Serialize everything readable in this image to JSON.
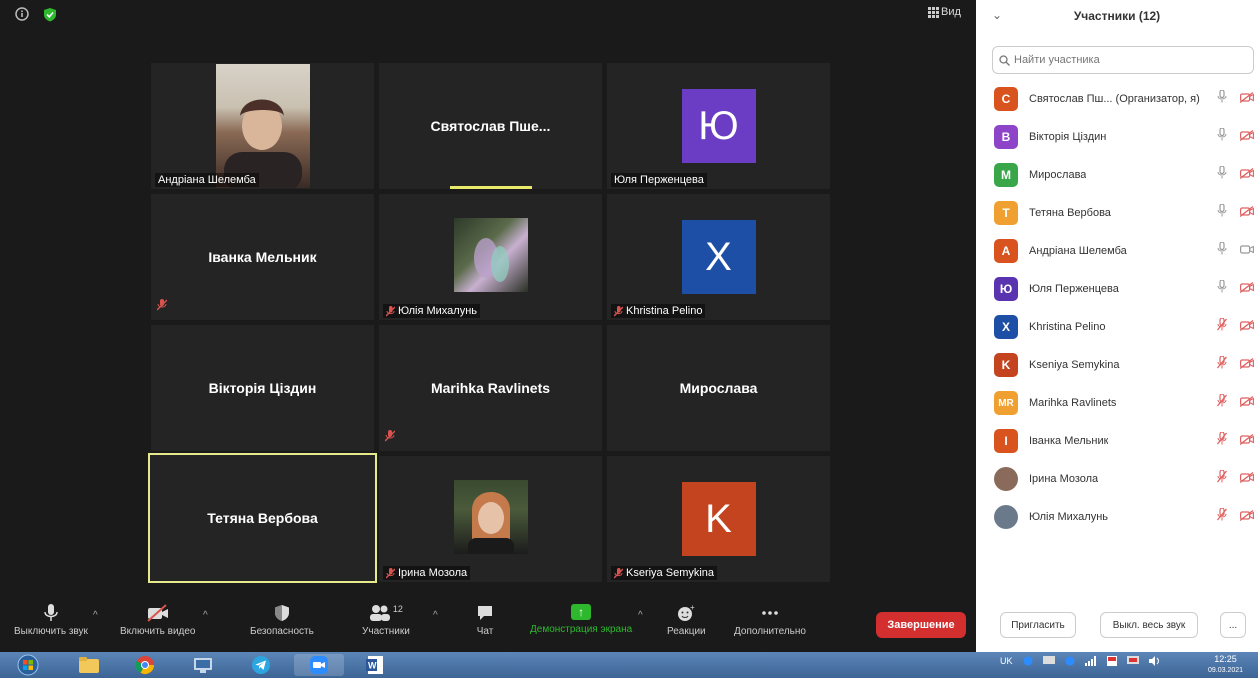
{
  "meeting": {
    "view_label": "Вид",
    "tiles": [
      {
        "name": "Андріана Шелемба",
        "kind": "photo"
      },
      {
        "name": "Святослав Пше...",
        "kind": "name",
        "active_speaker": true
      },
      {
        "name": "Юля Перженцева",
        "kind": "avatar",
        "letter": "Ю",
        "color": "#6a3dc4"
      },
      {
        "name": "Іванка Мельник",
        "kind": "name",
        "muted": true
      },
      {
        "name": "Юлія Михалунь",
        "kind": "photo",
        "muted": true
      },
      {
        "name": "Khristina Pelino",
        "kind": "avatar",
        "letter": "X",
        "color": "#1e4fa6",
        "muted": true
      },
      {
        "name": "Вікторія Ціздин",
        "kind": "name"
      },
      {
        "name": "Marihka Ravlinets",
        "kind": "name",
        "muted": true
      },
      {
        "name": "Мирослава",
        "kind": "name"
      },
      {
        "name": "Тетяна Вербова",
        "kind": "name",
        "highlighted": true
      },
      {
        "name": "Ірина Мозола",
        "kind": "photo",
        "muted": true
      },
      {
        "name": "Kseriya Semykina",
        "kind": "avatar",
        "letter": "K",
        "color": "#c4441f",
        "muted": true
      }
    ]
  },
  "toolbar": {
    "mute_label": "Выключить звук",
    "video_label": "Включить видео",
    "security_label": "Безопасность",
    "participants_label": "Участники",
    "participants_count": "12",
    "chat_label": "Чат",
    "share_label": "Демонстрация экрана",
    "reactions_label": "Реакции",
    "more_label": "Дополнительно",
    "end_label": "Завершение"
  },
  "panel": {
    "title": "Участники (12)",
    "search_placeholder": "Найти участника",
    "participants": [
      {
        "name": "Святослав Пш... (Организатор, я)",
        "initial": "С",
        "color": "#d9531e",
        "mic": "on",
        "cam": "off"
      },
      {
        "name": "Вікторія Ціздин",
        "initial": "В",
        "color": "#8e44c9",
        "mic": "on",
        "cam": "off"
      },
      {
        "name": "Мирослава",
        "initial": "М",
        "color": "#3aa64a",
        "mic": "on",
        "cam": "off"
      },
      {
        "name": "Тетяна Вербова",
        "initial": "Т",
        "color": "#f0a030",
        "mic": "on",
        "cam": "off"
      },
      {
        "name": "Андріана Шелемба",
        "initial": "А",
        "color": "#d9531e",
        "mic": "on",
        "cam": "on"
      },
      {
        "name": "Юля Перженцева",
        "initial": "Ю",
        "color": "#5a34b0",
        "mic": "on",
        "cam": "off"
      },
      {
        "name": "Khristina Pelino",
        "initial": "X",
        "color": "#1e4fa6",
        "mic": "muted",
        "cam": "off"
      },
      {
        "name": "Kseniya Semykina",
        "initial": "K",
        "color": "#c4441f",
        "mic": "muted",
        "cam": "off"
      },
      {
        "name": "Marihka Ravlinets",
        "initial": "MR",
        "color": "#f0a030",
        "mic": "muted",
        "cam": "off"
      },
      {
        "name": "Іванка Мельник",
        "initial": "І",
        "color": "#d9531e",
        "mic": "muted",
        "cam": "off"
      },
      {
        "name": "Ірина Мозола",
        "initial": "",
        "color": "#8a6a5a",
        "mic": "muted",
        "cam": "off"
      },
      {
        "name": "Юлія Михалунь",
        "initial": "",
        "color": "#6a7a8a",
        "mic": "muted",
        "cam": "off"
      }
    ],
    "invite_label": "Пригласить",
    "mute_all_label": "Выкл. весь звук",
    "more_label": "..."
  },
  "taskbar": {
    "lang": "UK",
    "time": "12:25",
    "date": "09.03.2021"
  },
  "colors": {
    "accent_green": "#2eb82e",
    "end_red": "#d32f2f",
    "speaker_yellow": "#e9e96a",
    "muted_red": "#d9534f"
  }
}
